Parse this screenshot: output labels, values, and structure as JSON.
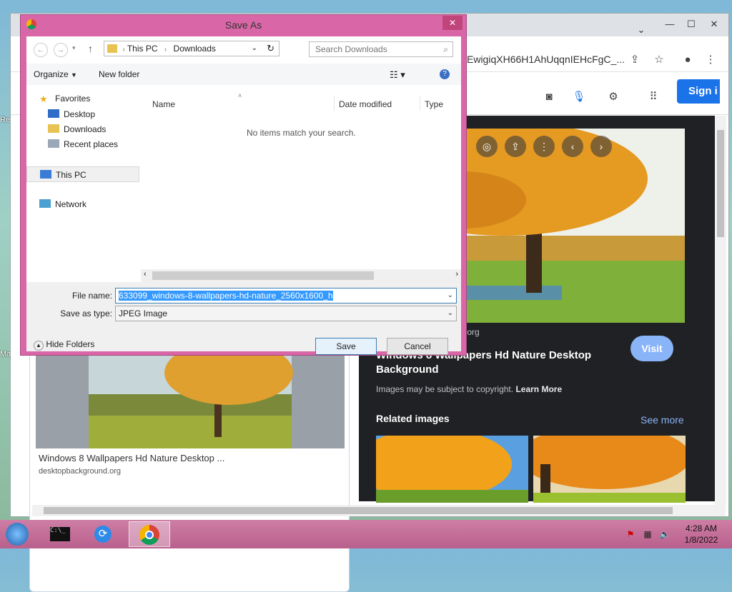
{
  "desktop": {
    "fragments": [
      "Re",
      "Ma"
    ]
  },
  "chrome": {
    "url": "EwigiqXH66H1AhUqqnIEHcFgC_...",
    "win_min": "—",
    "win_max": "☐",
    "win_close": "✕",
    "sign_in": "Sign i",
    "result_card": {
      "title": "Windows 8 Wallpapers Hd Nature Desktop ...",
      "source": "desktopbackground.org"
    },
    "side_panel": {
      "source_domain": ".org",
      "visit": "Visit",
      "title": "Windows 8 Wallpapers Hd Nature Desktop Background",
      "copyright": "Images may be subject to copyright.",
      "learn_more": "Learn More",
      "related": "Related images",
      "see_more": "See more"
    }
  },
  "dialog": {
    "title": "Save As",
    "close": "✕",
    "breadcrumb": [
      "This PC",
      "Downloads"
    ],
    "search_placeholder": "Search Downloads",
    "organize": "Organize",
    "new_folder": "New folder",
    "nav": {
      "favorites": "Favorites",
      "desktop": "Desktop",
      "downloads": "Downloads",
      "recent": "Recent places",
      "this_pc": "This PC",
      "network": "Network"
    },
    "columns": {
      "name": "Name",
      "date": "Date modified",
      "type": "Type"
    },
    "empty_message": "No items match your search.",
    "file_name_label": "File name:",
    "file_name_value": "633099_windows-8-wallpapers-hd-nature_2560x1600_h",
    "save_type_label": "Save as type:",
    "save_type_value": "JPEG Image",
    "hide_folders": "Hide Folders",
    "save": "Save",
    "cancel": "Cancel"
  },
  "taskbar": {
    "time": "4:28 AM",
    "date": "1/8/2022"
  }
}
